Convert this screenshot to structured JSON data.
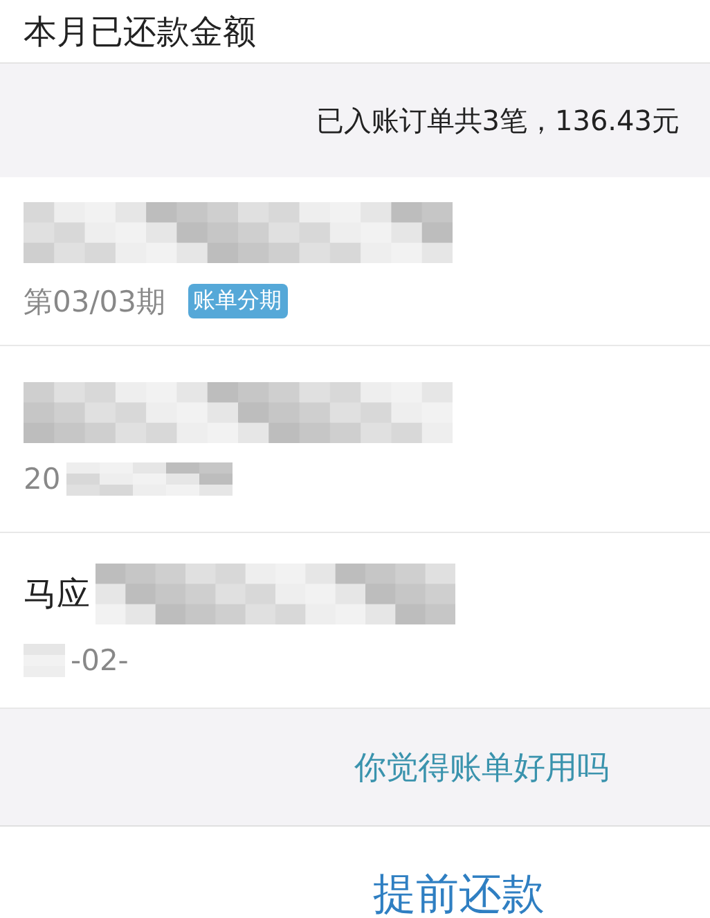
{
  "header": {
    "title": "本月已还款金额"
  },
  "summary": {
    "text": "已入账订单共3笔，136.43元"
  },
  "orders": [
    {
      "subtitle": "第03/03期",
      "tag": "账单分期"
    },
    {
      "subtitle": "20"
    },
    {
      "title": "马应",
      "subtitle": "-02-"
    }
  ],
  "feedback": {
    "text": "你觉得账单好用吗"
  },
  "action": {
    "label": "提前还款"
  }
}
